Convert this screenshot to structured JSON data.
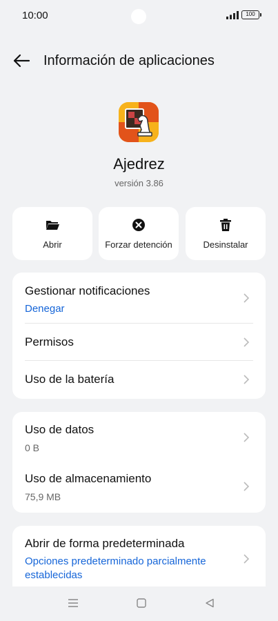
{
  "status": {
    "time": "10:00",
    "battery": "100"
  },
  "header": {
    "title": "Información de aplicaciones"
  },
  "app": {
    "name": "Ajedrez",
    "version": "versión 3.86"
  },
  "actions": [
    {
      "label": "Abrir",
      "icon": "folder-open-icon"
    },
    {
      "label": "Forzar detención",
      "icon": "close-circle-icon"
    },
    {
      "label": "Desinstalar",
      "icon": "trash-icon"
    }
  ],
  "card1": {
    "notifications": {
      "title": "Gestionar notificaciones",
      "value": "Denegar"
    },
    "permissions": {
      "title": "Permisos"
    },
    "battery": {
      "title": "Uso de la batería"
    }
  },
  "card2": {
    "data": {
      "title": "Uso de datos",
      "value": "0 B"
    },
    "storage": {
      "title": "Uso de almacenamiento",
      "value": "75,9 MB"
    }
  },
  "card3": {
    "defaults": {
      "title": "Abrir de forma predeterminada",
      "value_line1": "Opciones predeterminado parcialmente",
      "value_line2": "establecidas"
    }
  },
  "colors": {
    "accent": "#1565d8",
    "background": "#f1f2f4",
    "card": "#ffffff"
  }
}
